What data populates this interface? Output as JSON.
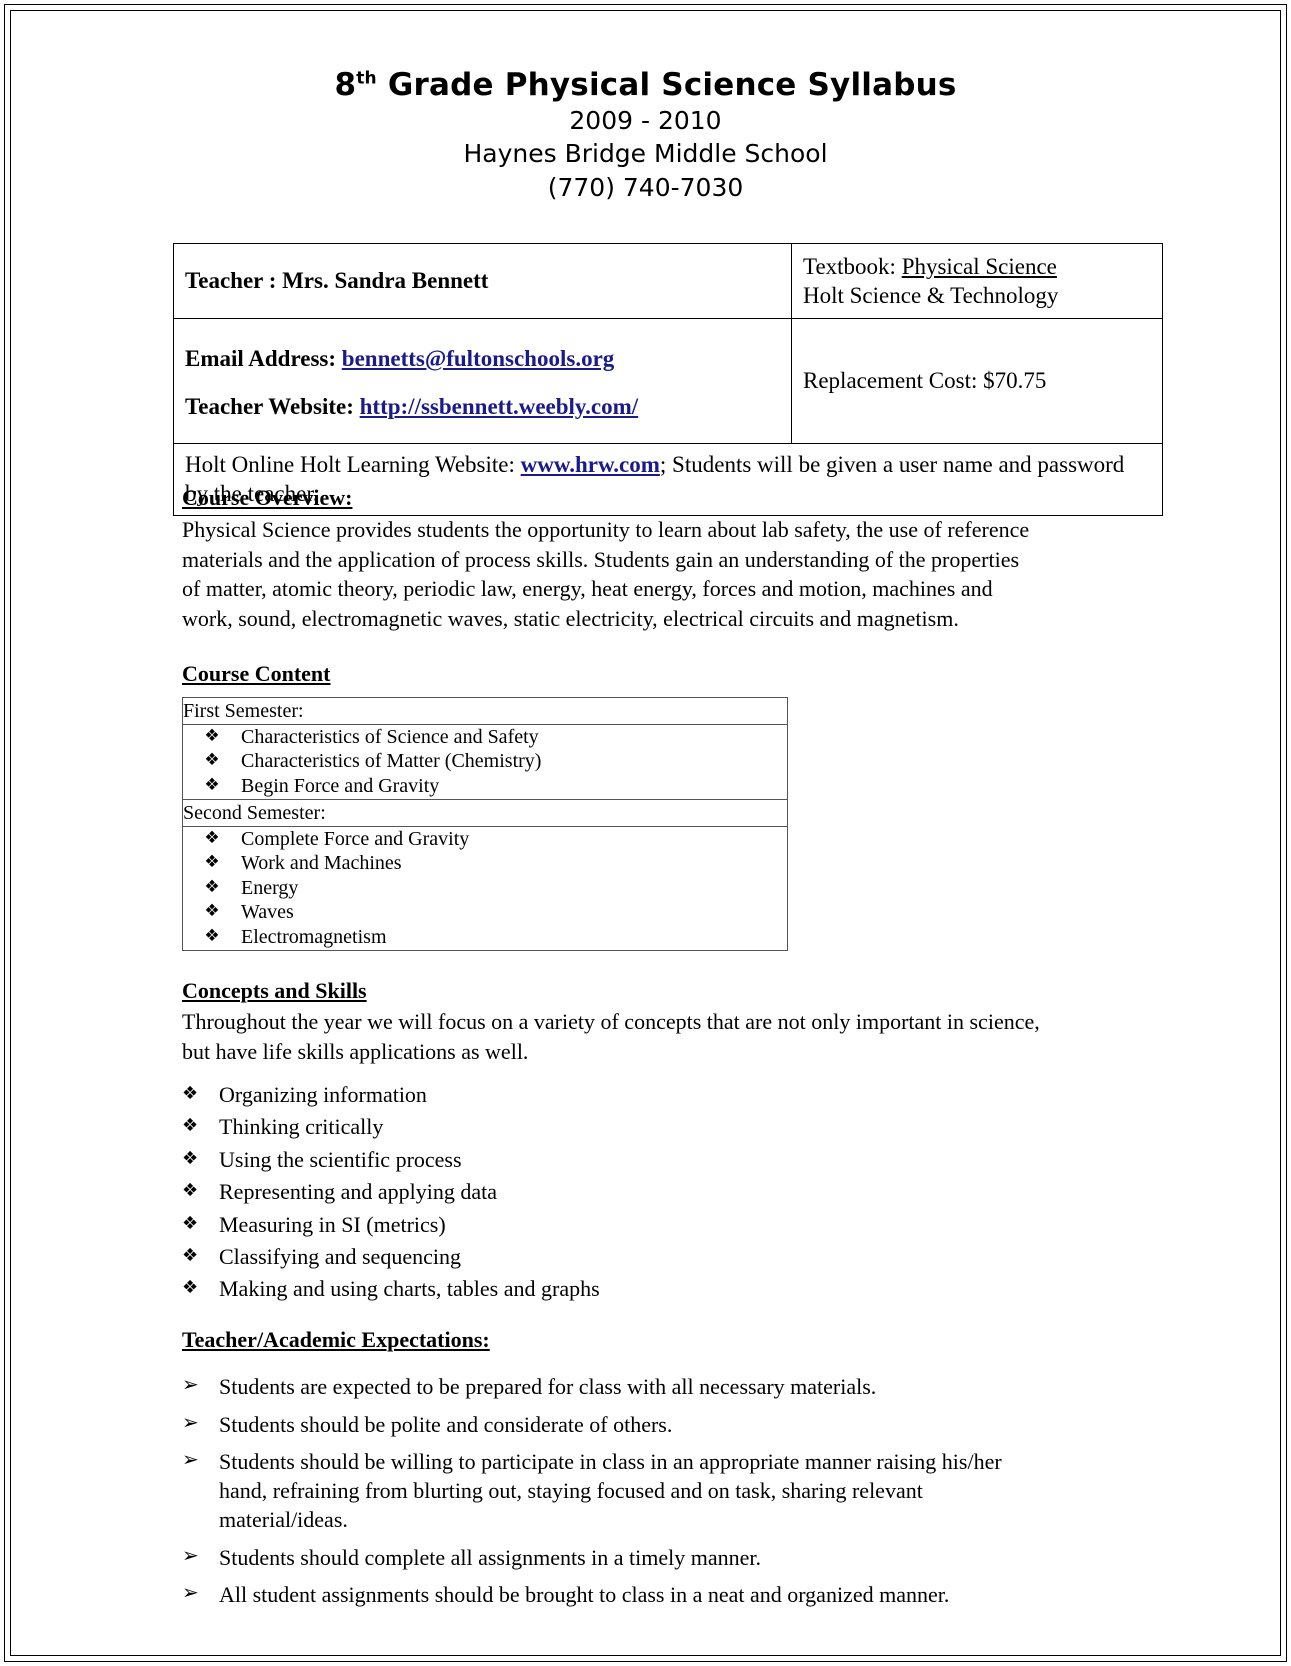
{
  "header": {
    "title_prefix": "8",
    "title_sup": "th",
    "title_rest": " Grade Physical Science Syllabus",
    "school_year": "2009 - 2010",
    "school_name": "Haynes Bridge Middle School",
    "phone": "(770) 740-7030"
  },
  "info_table": {
    "teacher_label": "Teacher : Mrs. Sandra Bennett",
    "textbook_label": "Textbook:",
    "textbook_title": "Physical Science",
    "textbook_publisher": "Holt Science & Technology",
    "email_label": "Email Address:",
    "email_value": "bennetts@fultonschools.org",
    "website_label": "Teacher Website:",
    "website_value": "http://ssbennett.weebly.com/",
    "replacement_cost": "Replacement Cost: $70.75",
    "online_label": "Holt Online Holt Learning Website:",
    "online_link": "www.hrw.com",
    "online_tail": "; Students will be given a user name and password by the teacher."
  },
  "course_overview": {
    "heading": "Course Overview:",
    "body": "Physical Science provides students the opportunity to learn about lab safety, the use of reference materials and the application of process skills.  Students gain an understanding of the properties of matter, atomic theory, periodic law, energy, heat energy, forces and motion, machines and work, sound, electromagnetic waves, static electricity, electrical circuits and magnetism."
  },
  "course_content": {
    "heading": "Course Content",
    "semesters": [
      {
        "label": "First Semester:",
        "items": [
          "Characteristics of Science and Safety",
          "Characteristics of Matter (Chemistry)",
          "Begin Force and Gravity"
        ]
      },
      {
        "label": "Second Semester:",
        "items": [
          "Complete Force and Gravity",
          "Work and Machines",
          "Energy",
          "Waves",
          "Electromagnetism"
        ]
      }
    ]
  },
  "concepts_and_skills": {
    "heading": "Concepts and Skills",
    "body": "Throughout the year we will focus on a variety of concepts that are not only important in science, but have life skills applications as well.",
    "items": [
      "Organizing information",
      "Thinking critically",
      "Using the scientific process",
      "Representing and applying data",
      "Measuring in SI (metrics)",
      "Classifying and sequencing",
      "Making and using charts, tables and graphs"
    ]
  },
  "expectations": {
    "heading": "Teacher/Academic Expectations:",
    "items": [
      "Students are expected to be prepared for class with all necessary materials.",
      "Students should be polite and considerate of others.",
      "Students should be willing to participate in class in an appropriate manner raising his/her hand, refraining from blurting out, staying focused and on task, sharing relevant material/ideas.",
      "Students should complete all assignments in a timely manner.",
      "All student assignments should be brought to class in a neat and organized manner."
    ]
  },
  "glyphs": {
    "diamond_bullet": "❖",
    "arrow_bullet": "➢"
  },
  "colors": {
    "link": "#1a1a8c",
    "text": "#000000",
    "border": "#000000"
  }
}
